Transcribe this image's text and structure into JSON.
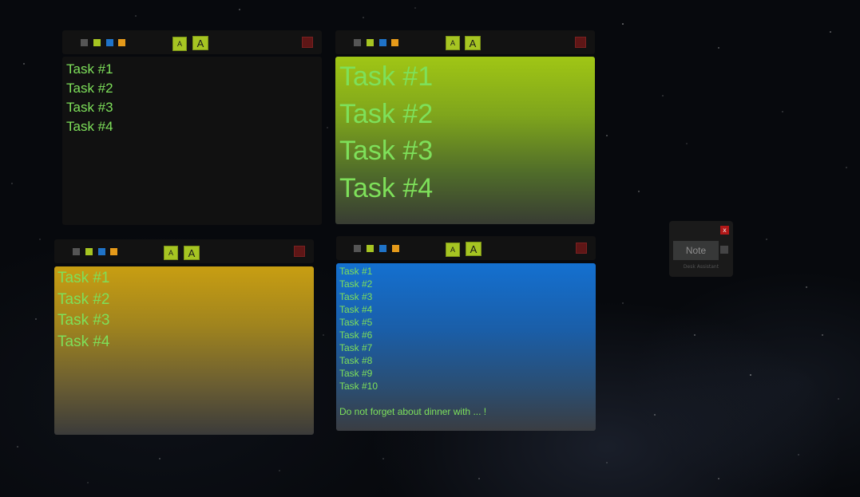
{
  "colors": {
    "gray": "#555555",
    "lime": "#a6c522",
    "blue": "#1f73c8",
    "orange": "#e59a1a",
    "text": "#7ee05a",
    "close": "#5e1616"
  },
  "toolbar": {
    "font_small_label": "A",
    "font_large_label": "A"
  },
  "notes": {
    "n1": {
      "theme": "black",
      "tasks": [
        "Task #1",
        "Task #2",
        "Task #3",
        "Task #4"
      ]
    },
    "n2": {
      "theme": "lime",
      "tasks": [
        "Task #1",
        "Task #2",
        "Task #3",
        "Task #4"
      ]
    },
    "n3": {
      "theme": "amber",
      "tasks": [
        "Task #1",
        "Task #2",
        "Task #3",
        "Task #4"
      ]
    },
    "n4": {
      "theme": "blue",
      "tasks": [
        "Task #1",
        "Task #2",
        "Task #3",
        "Task #4",
        "Task #5",
        "Task #6",
        "Task #7",
        "Task #8",
        "Task #9",
        "Task #10"
      ],
      "memo": "Do not forget about dinner with ... !"
    }
  },
  "launcher": {
    "close_label": "x",
    "note_button": "Note",
    "footer": "Desk Assistant"
  }
}
